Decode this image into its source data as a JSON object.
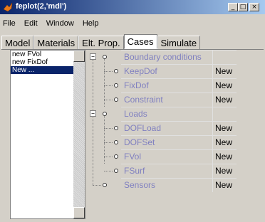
{
  "window": {
    "title": "feplot(2,'mdl')",
    "buttons": [
      "_",
      "□",
      "×"
    ]
  },
  "menu": [
    "File",
    "Edit",
    "Window",
    "Help"
  ],
  "tabs": [
    "Model",
    "Materials",
    "Elt. Prop.",
    "Cases",
    "Simulate"
  ],
  "active_tab": "Cases",
  "case_list": {
    "items": [
      "new FVol",
      "new FixDof",
      "New ..."
    ],
    "selected": "New ..."
  },
  "tree": [
    {
      "label": "Boundary conditions",
      "value": ""
    },
    {
      "label": "KeepDof",
      "value": "New"
    },
    {
      "label": "FixDof",
      "value": "New"
    },
    {
      "label": "Constraint",
      "value": "New"
    },
    {
      "label": "Loads",
      "value": ""
    },
    {
      "label": "DOFLoad",
      "value": "New"
    },
    {
      "label": "DOFSet",
      "value": "New"
    },
    {
      "label": "FVol",
      "value": "New"
    },
    {
      "label": "FSurf",
      "value": "New"
    },
    {
      "label": "Sensors",
      "value": "New"
    }
  ],
  "icons": {
    "app": "matlab-icon",
    "expander": "minus-box-icon",
    "node": "circle-node-icon"
  }
}
